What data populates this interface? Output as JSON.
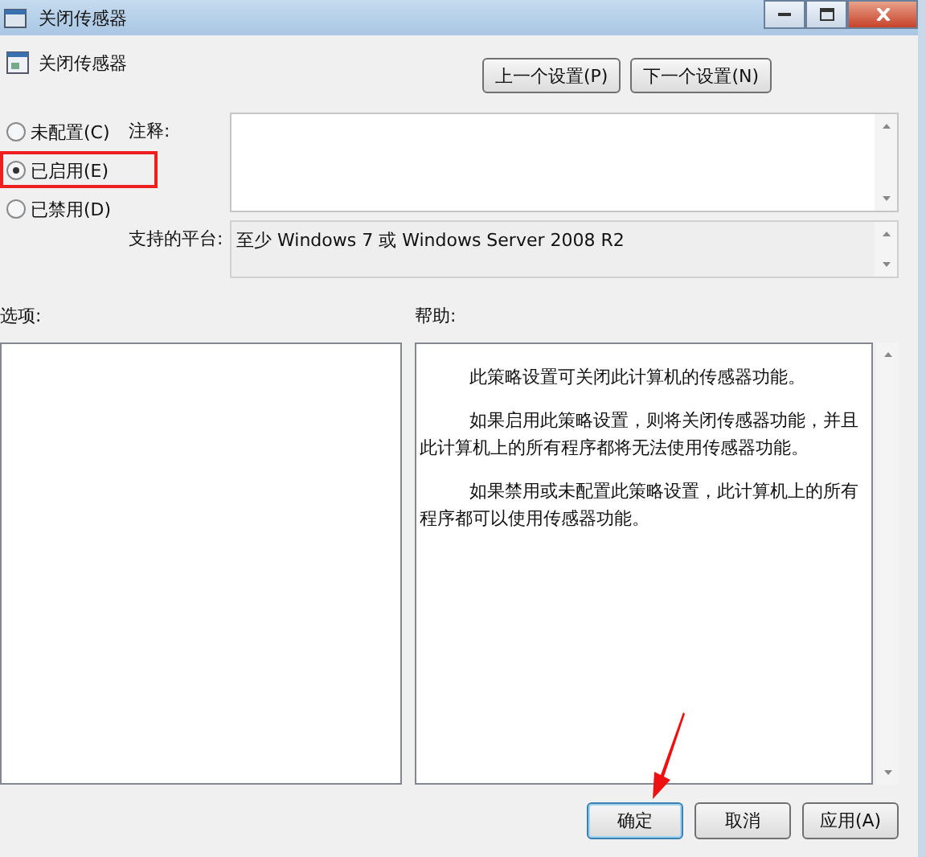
{
  "window": {
    "title": "关闭传感器"
  },
  "header": {
    "title": "关闭传感器"
  },
  "nav_buttons": [
    "上一个设置(P)",
    "下一个设置(N)"
  ],
  "radios": [
    {
      "label": "未配置(C)",
      "selected": false
    },
    {
      "label": "已启用(E)",
      "selected": true
    },
    {
      "label": "已禁用(D)",
      "selected": false
    }
  ],
  "note_label": "注释:",
  "platform_label": "支持的平台:",
  "platform": "至少 Windows 7 或 Windows Server 2008 R2",
  "options_label": "选项:",
  "help_label": "帮助:",
  "help": [
    "此策略设置可关闭此计算机的传感器功能。",
    "如果启用此策略设置，则将关闭传感器功能，并且此计算机上的所有程序都将无法使用传感器功能。",
    "如果禁用或未配置此策略设置，此计算机上的所有程序都可以使用传感器功能。"
  ],
  "buttons": [
    {
      "label": "确定",
      "kind": "default"
    },
    {
      "label": "取消",
      "kind": "normal"
    },
    {
      "label": "应用(A)",
      "kind": "normal"
    }
  ]
}
